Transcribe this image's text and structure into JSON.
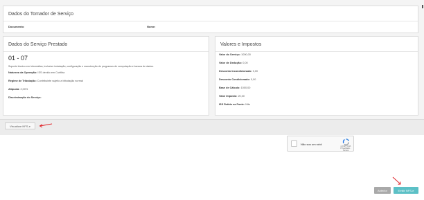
{
  "tomador": {
    "title": "Dados do Tomador de Serviço",
    "documento_label": "Documento:",
    "nome_label": "Nome:"
  },
  "servico": {
    "title": "Dados do Serviço Prestado",
    "codigo": "01 - 07",
    "descricao": "Suporte técnico em informática, inclusive instalação, configuração e manutenção de programas de computação e bancos de dados.",
    "natureza_label": "Natureza da Operação:",
    "natureza_value": "ISS devido em Curitiba",
    "regime_label": "Regime de Tributação:",
    "regime_value": "Contribuinte sujeito a tributação normal",
    "aliquota_label": "Alíquota:",
    "aliquota_value": "2,00%",
    "discriminacao_label": "Discriminação do Serviço:"
  },
  "valores": {
    "title": "Valores e Impostos",
    "rows": [
      {
        "label": "Valor do Serviço:",
        "value": "1000,00"
      },
      {
        "label": "Valor de Dedução:",
        "value": "0,00"
      },
      {
        "label": "Desconto Incondicionado:",
        "value": "0,00"
      },
      {
        "label": "Desconto Condicionado:",
        "value": "0,00"
      },
      {
        "label": "Base de Cálculo:",
        "value": "1000,00"
      },
      {
        "label": "Valor Imposto:",
        "value": "20,00"
      },
      {
        "label": "ISS Retido na Fonte:",
        "value": "Não"
      }
    ]
  },
  "actions": {
    "visualizar_label": "Visualizar NFS-e",
    "anterior_label": "Anterior",
    "emitir_label": "Emitir NFS-e"
  },
  "captcha": {
    "label": "Não sou um robô",
    "brand": "reCAPTCHA",
    "links": "Privacidade - Termos"
  },
  "colors": {
    "accent": "#5cc0c6",
    "annotation_arrow": "#e0242a"
  }
}
